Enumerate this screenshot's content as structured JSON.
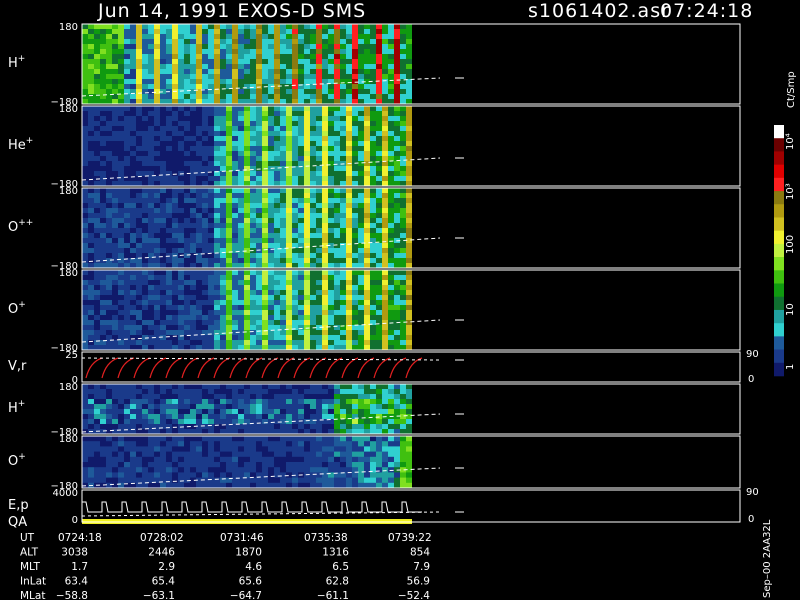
{
  "header": {
    "title": "Jun 14, 1991    EXOS-D SMS",
    "file": "s1061402.asr",
    "time": "07:24:18"
  },
  "colorbar": {
    "unit": "Ct/Smp",
    "labels": [
      "10⁴",
      "10³",
      "100",
      "10",
      "1"
    ],
    "colors": [
      "#ffffff",
      "#6a0000",
      "#a00000",
      "#e00000",
      "#ff2020",
      "#8a7a10",
      "#b09a10",
      "#d0c020",
      "#f0f030",
      "#c0f040",
      "#80e020",
      "#40c010",
      "#109a10",
      "#107030",
      "#20a0a0",
      "#30d0d0",
      "#1e5a9a",
      "#1a3a8a",
      "#101a6a"
    ]
  },
  "panels": [
    {
      "label": "H",
      "sup": "+",
      "top": "180",
      "bottom": "−180"
    },
    {
      "label": "He",
      "sup": "+",
      "top": "180",
      "bottom": "−180"
    },
    {
      "label": "O",
      "sup": "++",
      "top": "180",
      "bottom": "−180"
    },
    {
      "label": "O",
      "sup": "+",
      "top": "180",
      "bottom": "−180"
    },
    {
      "label": "V,r",
      "sup": "",
      "top": "25",
      "bottom": "0",
      "right_top": "90",
      "right_bottom": "0"
    },
    {
      "label": "H",
      "sup": "+",
      "top": "180",
      "bottom": "−180"
    },
    {
      "label": "O",
      "sup": "+",
      "top": "180",
      "bottom": "−180"
    },
    {
      "label": "E,p",
      "sup": "",
      "label2": "QA",
      "top": "4000",
      "bottom": "0",
      "right_top": "90",
      "right_bottom": "0"
    }
  ],
  "footer": {
    "right_label": "Sep–00  2AA32L",
    "rows": [
      {
        "name": "UT",
        "values": [
          "0724:18",
          "0728:02",
          "0731:46",
          "0735:38",
          "0739:22"
        ]
      },
      {
        "name": "ALT",
        "values": [
          "3038",
          "2446",
          "1870",
          "1316",
          "854"
        ]
      },
      {
        "name": "MLT",
        "values": [
          "1.7",
          "2.9",
          "4.6",
          "6.5",
          "7.9"
        ]
      },
      {
        "name": "InLat",
        "values": [
          "63.4",
          "65.4",
          "65.6",
          "62.8",
          "56.9"
        ]
      },
      {
        "name": "MLat",
        "values": [
          "−58.8",
          "−63.1",
          "−64.7",
          "−61.1",
          "−52.4"
        ]
      }
    ]
  },
  "chart_data": {
    "type": "heatmap",
    "title": "Jun 14, 1991    EXOS-D SMS",
    "x_tick_labels": [
      "0724:18",
      "0728:02",
      "0731:46",
      "0735:38",
      "0739:22"
    ],
    "colorbar_unit": "Ct/Smp",
    "colorbar_range": [
      1,
      10000
    ],
    "colorbar_scale": "log",
    "panels": [
      {
        "label": "H+",
        "ylim": [
          -180,
          180
        ]
      },
      {
        "label": "He+",
        "ylim": [
          -180,
          180
        ]
      },
      {
        "label": "O++",
        "ylim": [
          -180,
          180
        ]
      },
      {
        "label": "O+",
        "ylim": [
          -180,
          180
        ]
      },
      {
        "label": "V,r",
        "ylim": [
          0,
          25
        ],
        "ylim_right": [
          0,
          90
        ]
      },
      {
        "label": "H+",
        "ylim": [
          -180,
          180
        ]
      },
      {
        "label": "O+",
        "ylim": [
          -180,
          180
        ]
      },
      {
        "label": "E,p / QA",
        "ylim": [
          0,
          4000
        ],
        "ylim_right": [
          0,
          90
        ]
      }
    ]
  }
}
